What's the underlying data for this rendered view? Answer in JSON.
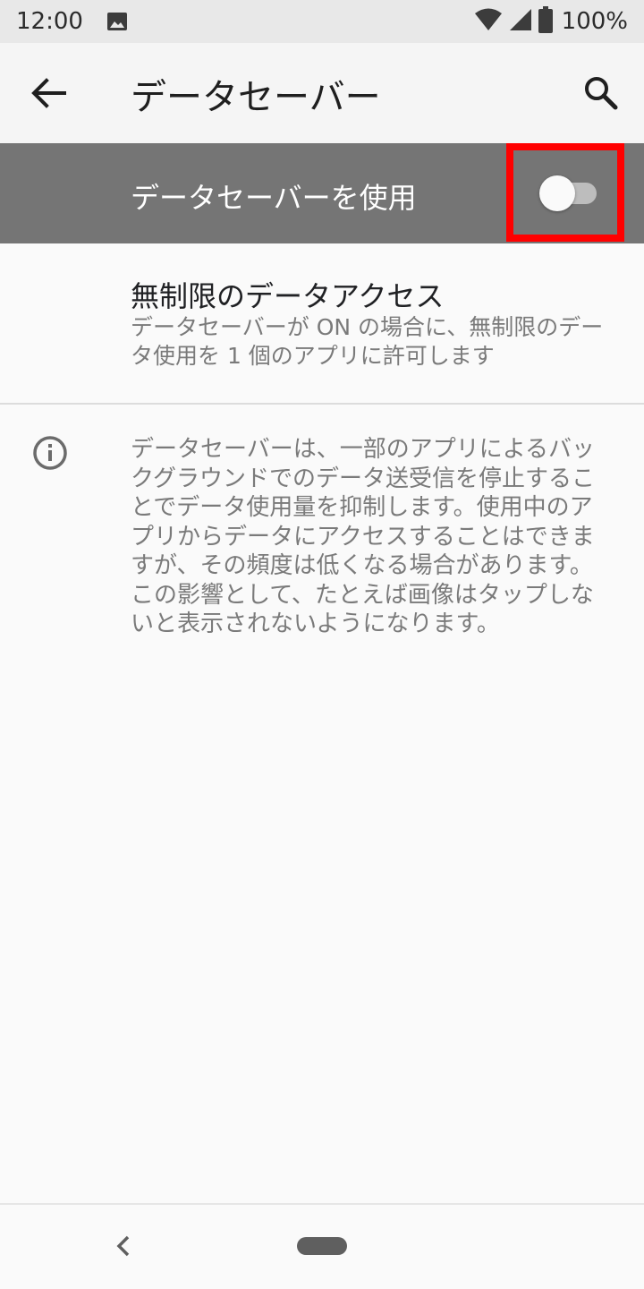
{
  "status_bar": {
    "time": "12:00",
    "battery": "100%",
    "icons": [
      "image-icon",
      "wifi-icon",
      "cellular-icon",
      "battery-icon"
    ]
  },
  "app_bar": {
    "title": "データセーバー",
    "icons": [
      "back-arrow-icon",
      "search-icon"
    ]
  },
  "master_switch": {
    "label": "データセーバーを使用",
    "state": "off"
  },
  "unrestricted": {
    "title": "無制限のデータアクセス",
    "summary": "データセーバーが ON の場合に、無制限のデータ使用を 1 個のアプリに許可します"
  },
  "info": {
    "icon": "info-icon",
    "text": "データセーバーは、一部のアプリによるバックグラウンドでのデータ送受信を停止することでデータ使用量を抑制します。使用中のアプリからデータにアクセスすることはできますが、その頻度は低くなる場合があります。この影響として、たとえば画像はタップしないと表示されないようになります。"
  },
  "nav_bar": {
    "icons": [
      "nav-back-icon",
      "home-pill"
    ]
  },
  "colors": {
    "master_bg": "#757575",
    "highlight": "#ff0000",
    "secondary_text": "#7a7a7a"
  }
}
